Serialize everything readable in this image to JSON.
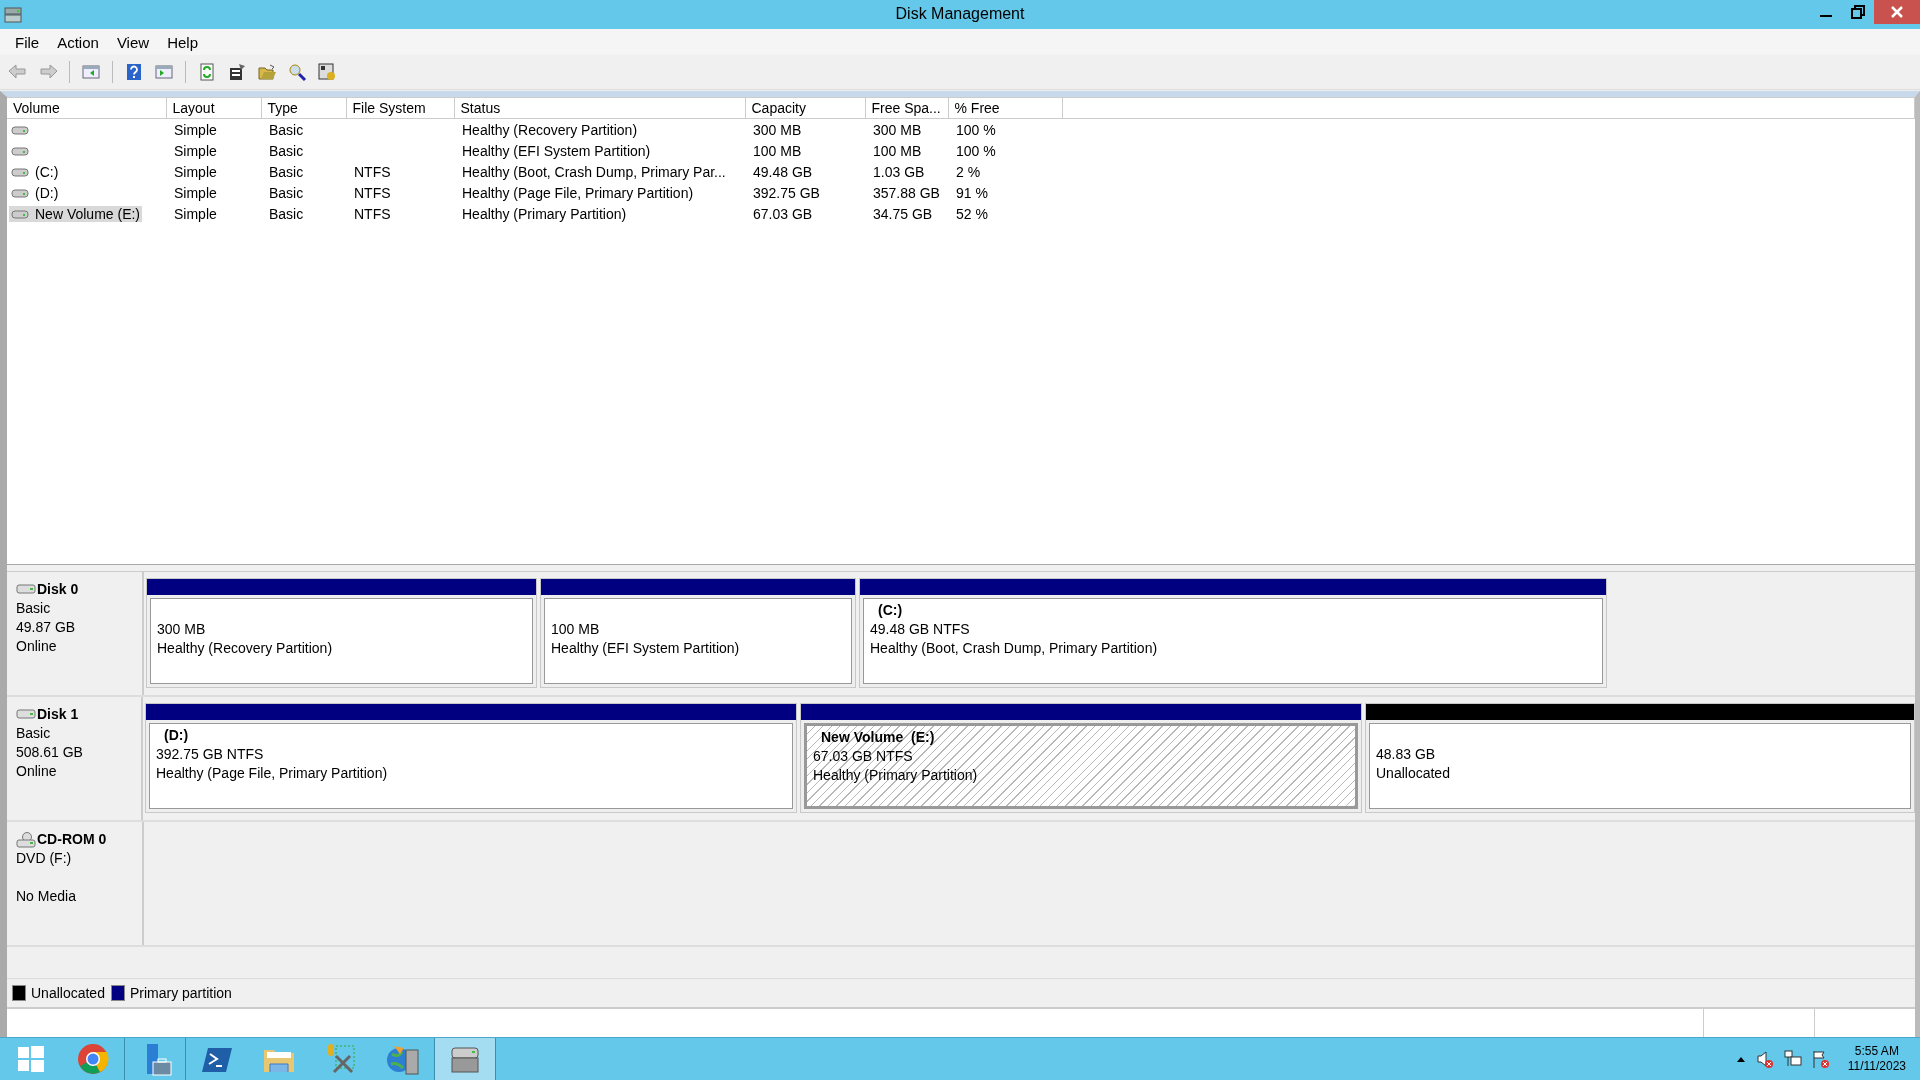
{
  "window": {
    "title": "Disk Management"
  },
  "menu": [
    "File",
    "Action",
    "View",
    "Help"
  ],
  "toolbar": [
    {
      "kind": "back",
      "disabled": true
    },
    {
      "kind": "forward",
      "disabled": true
    },
    {
      "kind": "sep"
    },
    {
      "kind": "tree",
      "disabled": false
    },
    {
      "kind": "sep"
    },
    {
      "kind": "help",
      "disabled": false
    },
    {
      "kind": "pane",
      "disabled": false
    },
    {
      "kind": "sep"
    },
    {
      "kind": "refresh",
      "disabled": false
    },
    {
      "kind": "properties",
      "disabled": false
    },
    {
      "kind": "open",
      "disabled": false
    },
    {
      "kind": "find",
      "disabled": false
    },
    {
      "kind": "settings",
      "disabled": false
    }
  ],
  "table": {
    "columns": [
      "Volume",
      "Layout",
      "Type",
      "File System",
      "Status",
      "Capacity",
      "Free Spa...",
      "% Free"
    ],
    "rows": [
      {
        "volume": "",
        "layout": "Simple",
        "type": "Basic",
        "file_system": "",
        "status": "Healthy (Recovery Partition)",
        "capacity": "300 MB",
        "free_space": "300 MB",
        "percent_free": "100 %",
        "selected": false
      },
      {
        "volume": "",
        "layout": "Simple",
        "type": "Basic",
        "file_system": "",
        "status": "Healthy (EFI System Partition)",
        "capacity": "100 MB",
        "free_space": "100 MB",
        "percent_free": "100 %",
        "selected": false
      },
      {
        "volume": "(C:)",
        "layout": "Simple",
        "type": "Basic",
        "file_system": "NTFS",
        "status": "Healthy (Boot, Crash Dump, Primary Par...",
        "capacity": "49.48 GB",
        "free_space": "1.03 GB",
        "percent_free": "2 %",
        "selected": false
      },
      {
        "volume": "(D:)",
        "layout": "Simple",
        "type": "Basic",
        "file_system": "NTFS",
        "status": "Healthy (Page File, Primary Partition)",
        "capacity": "392.75 GB",
        "free_space": "357.88 GB",
        "percent_free": "91 %",
        "selected": false
      },
      {
        "volume": "New Volume (E:)",
        "layout": "Simple",
        "type": "Basic",
        "file_system": "NTFS",
        "status": "Healthy (Primary Partition)",
        "capacity": "67.03 GB",
        "free_space": "34.75 GB",
        "percent_free": "52 %",
        "selected": true
      }
    ]
  },
  "disks": [
    {
      "kind": "disk",
      "name": "Disk 0",
      "type": "Basic",
      "size": "49.87 GB",
      "status": "Online",
      "partitions": [
        {
          "kind": "primary",
          "size": "300 MB",
          "status": "Healthy (Recovery Partition)",
          "selected": false
        },
        {
          "kind": "primary",
          "size": "100 MB",
          "status": "Healthy (EFI System Partition)",
          "selected": false
        },
        {
          "kind": "primary",
          "name": "(C:)",
          "size": "49.48 GB NTFS",
          "status": "Healthy (Boot, Crash Dump, Primary Partition)",
          "selected": false
        }
      ]
    },
    {
      "kind": "disk",
      "name": "Disk 1",
      "type": "Basic",
      "size": "508.61 GB",
      "status": "Online",
      "partitions": [
        {
          "kind": "primary",
          "name": "(D:)",
          "size": "392.75 GB NTFS",
          "status": "Healthy (Page File, Primary Partition)",
          "selected": false
        },
        {
          "kind": "primary",
          "name": "New Volume  (E:)",
          "size": "67.03 GB NTFS",
          "status": "Healthy (Primary Partition)",
          "selected": true
        },
        {
          "kind": "unallocated",
          "size": "48.83 GB",
          "status": "Unallocated",
          "selected": false
        }
      ]
    },
    {
      "kind": "cdrom",
      "name": "CD-ROM 0",
      "type": "DVD (F:)",
      "status": "No Media"
    }
  ],
  "legend": [
    {
      "label": "Unallocated",
      "color": "#000000"
    },
    {
      "label": "Primary partition",
      "color": "#000080"
    }
  ],
  "taskbar": {
    "buttons": [
      {
        "kind": "start",
        "selected": false
      },
      {
        "kind": "chrome",
        "selected": false
      },
      {
        "kind": "server",
        "selected": false
      },
      {
        "kind": "powershell",
        "selected": false
      },
      {
        "kind": "explorer",
        "selected": false
      },
      {
        "kind": "tools",
        "selected": false
      },
      {
        "kind": "network",
        "selected": false
      },
      {
        "kind": "disk",
        "selected": true
      }
    ],
    "time": "5:55 AM",
    "date": "11/11/2023"
  }
}
